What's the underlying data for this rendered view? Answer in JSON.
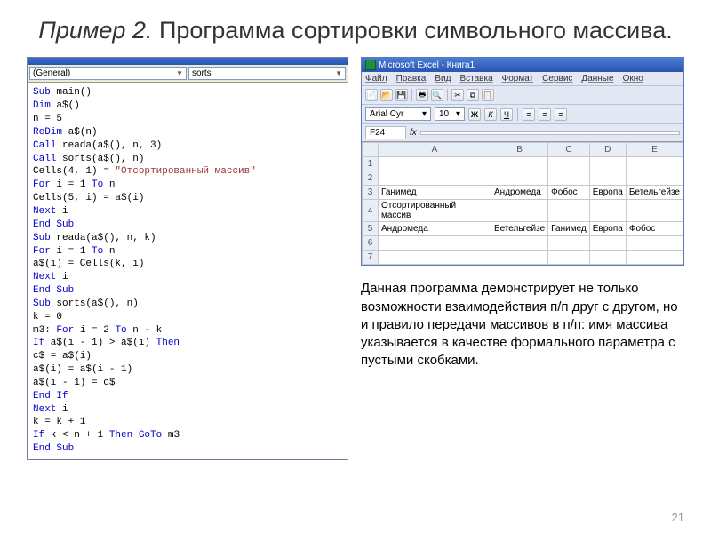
{
  "title": {
    "prefix": "Пример 2.",
    "rest": " Программа сортировки символьного массива."
  },
  "vba": {
    "dropdown1": "(General)",
    "dropdown2": "sorts",
    "lines": [
      [
        [
          "kw",
          "Sub"
        ],
        [
          "",
          " main()"
        ]
      ],
      [
        [
          "kw",
          "Dim"
        ],
        [
          "",
          " a$()"
        ]
      ],
      [
        [
          "",
          "n = 5"
        ]
      ],
      [
        [
          "kw",
          "ReDim"
        ],
        [
          "",
          " a$(n)"
        ]
      ],
      [
        [
          "kw",
          "Call"
        ],
        [
          "",
          " reada(a$(), n, 3)"
        ]
      ],
      [
        [
          "kw",
          "Call"
        ],
        [
          "",
          " sorts(a$(), n)"
        ]
      ],
      [
        [
          "",
          "Cells(4, 1) = "
        ],
        [
          "str",
          "\"Отсортированный массив\""
        ]
      ],
      [
        [
          "kw",
          "For"
        ],
        [
          "",
          " i = 1 "
        ],
        [
          "kw",
          "To"
        ],
        [
          "",
          " n"
        ]
      ],
      [
        [
          "",
          "Cells(5, i) = a$(i)"
        ]
      ],
      [
        [
          "kw",
          "Next"
        ],
        [
          "",
          " i"
        ]
      ],
      [
        [
          "kw",
          "End Sub"
        ]
      ],
      [
        [
          "",
          ""
        ]
      ],
      [
        [
          "kw",
          "Sub"
        ],
        [
          "",
          " reada(a$(), n, k)"
        ]
      ],
      [
        [
          "kw",
          "For"
        ],
        [
          "",
          " i = 1 "
        ],
        [
          "kw",
          "To"
        ],
        [
          "",
          " n"
        ]
      ],
      [
        [
          "",
          "a$(i) = Cells(k, i)"
        ]
      ],
      [
        [
          "kw",
          "Next"
        ],
        [
          "",
          " i"
        ]
      ],
      [
        [
          "kw",
          "End Sub"
        ]
      ],
      [
        [
          "",
          ""
        ]
      ],
      [
        [
          "kw",
          "Sub"
        ],
        [
          "",
          " sorts(a$(), n)"
        ]
      ],
      [
        [
          "",
          "k = 0"
        ]
      ],
      [
        [
          "",
          "m3: "
        ],
        [
          "kw",
          "For"
        ],
        [
          "",
          " i = 2 "
        ],
        [
          "kw",
          "To"
        ],
        [
          "",
          " n - k"
        ]
      ],
      [
        [
          "kw",
          "If"
        ],
        [
          "",
          " a$(i - 1) > a$(i) "
        ],
        [
          "kw",
          "Then"
        ]
      ],
      [
        [
          "",
          "c$ = a$(i)"
        ]
      ],
      [
        [
          "",
          "a$(i) = a$(i - 1)"
        ]
      ],
      [
        [
          "",
          "a$(i - 1) = c$"
        ]
      ],
      [
        [
          "kw",
          "End If"
        ]
      ],
      [
        [
          "kw",
          "Next"
        ],
        [
          "",
          " i"
        ]
      ],
      [
        [
          "",
          "k = k + 1"
        ]
      ],
      [
        [
          "kw",
          "If"
        ],
        [
          "",
          " k < n + 1 "
        ],
        [
          "kw",
          "Then GoTo"
        ],
        [
          "",
          " m3"
        ]
      ],
      [
        [
          "kw",
          "End Sub"
        ]
      ]
    ]
  },
  "excel": {
    "title": "Microsoft Excel - Книга1",
    "menu": [
      "Файл",
      "Правка",
      "Вид",
      "Вставка",
      "Формат",
      "Сервис",
      "Данные",
      "Окно"
    ],
    "font": "Arial Cyr",
    "size": "10",
    "bold": "Ж",
    "italic": "К",
    "underline": "Ч",
    "cellref": "F24",
    "fx": "fx",
    "cols": [
      "A",
      "B",
      "C",
      "D",
      "E"
    ],
    "rows": [
      [
        "",
        "",
        "",
        "",
        ""
      ],
      [
        "",
        "",
        "",
        "",
        ""
      ],
      [
        "Ганимед",
        "Андромеда",
        "Фобос",
        "Европа",
        "Бетельгейзе"
      ],
      [
        "Отсортированный массив",
        "",
        "",
        "",
        ""
      ],
      [
        "Андромеда",
        "Бетельгейзе",
        "Ганимед",
        "Европа",
        "Фобос"
      ],
      [
        "",
        "",
        "",
        "",
        ""
      ],
      [
        "",
        "",
        "",
        "",
        ""
      ]
    ]
  },
  "desc": "Данная программа демонстрирует не только возможности взаимодействия п/п друг с другом, но и правило передачи массивов в п/п: имя массива указывается в качестве формального параметра с пустыми скобками.",
  "pnum": "21"
}
